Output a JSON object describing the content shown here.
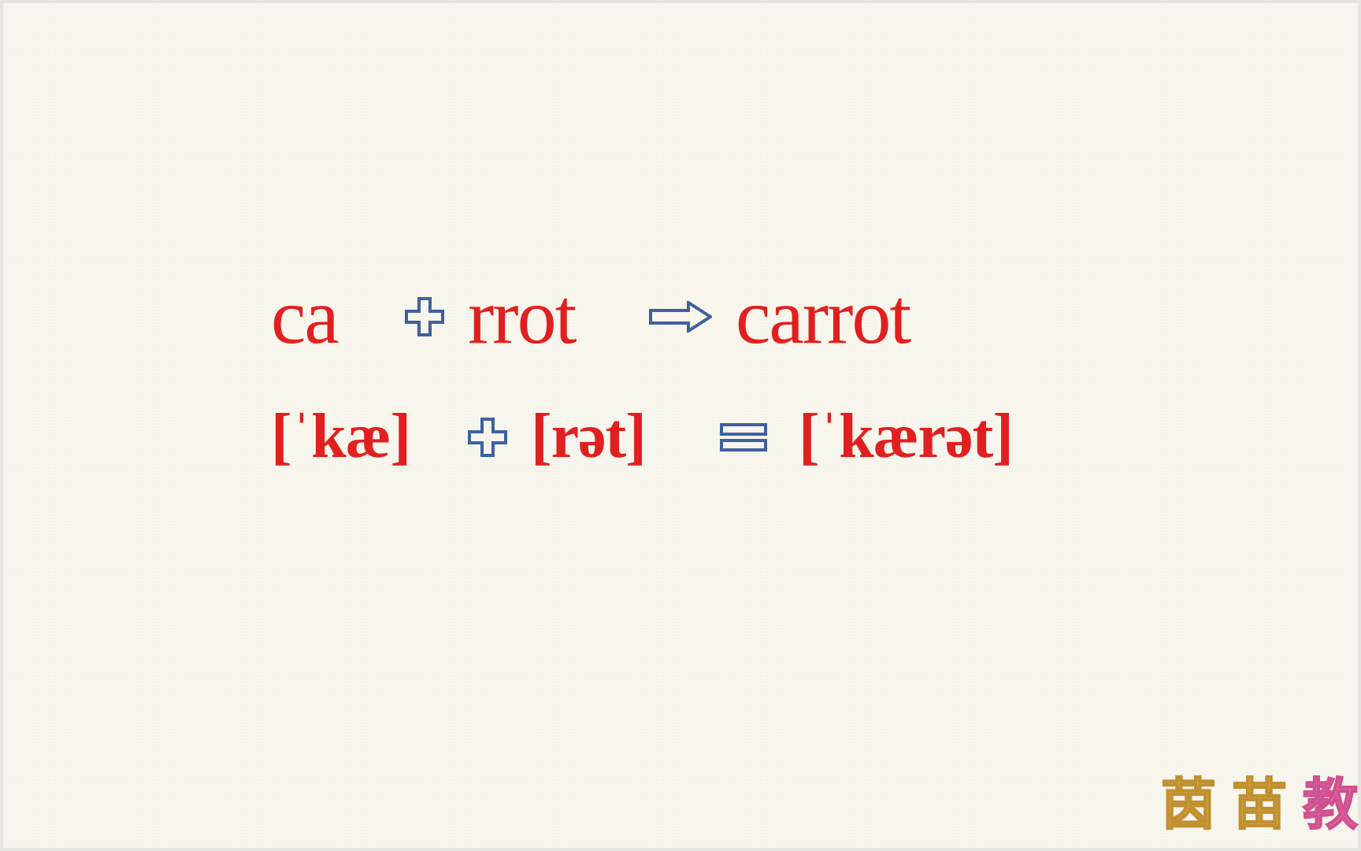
{
  "row1": {
    "segment1": "ca",
    "segment2": "rrot",
    "result": "carrot"
  },
  "row2": {
    "segment1": "[ˈkæ]",
    "segment2": "[rət]",
    "result": "[ˈkærət]"
  },
  "watermark": {
    "char1": "茵",
    "char2": "苗",
    "char3": "教"
  },
  "colors": {
    "text_red": "#e02020",
    "icon_blue": "#4060a0",
    "background": "#f8f6ed"
  }
}
